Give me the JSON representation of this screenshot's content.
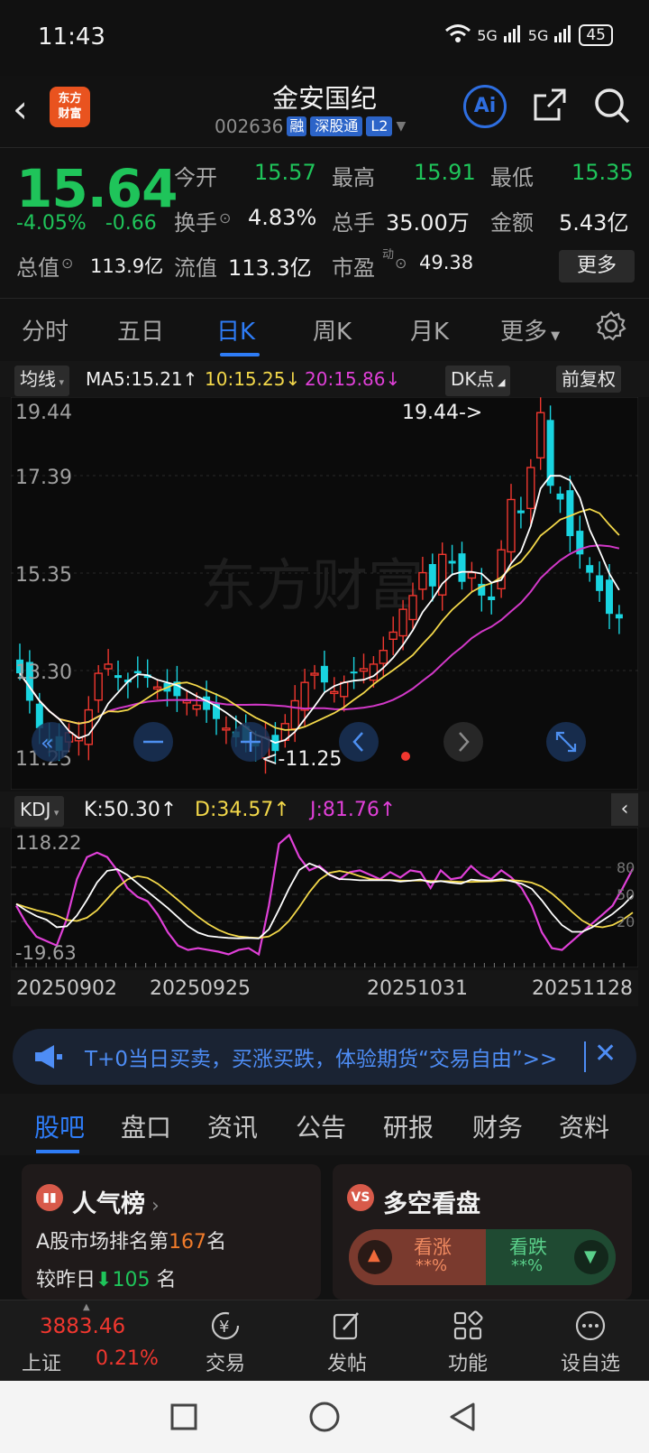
{
  "status_bar": {
    "time": "11:43",
    "signal1": "5G",
    "signal2": "5G",
    "battery": "45"
  },
  "header": {
    "logo_line1": "东方",
    "logo_line2": "财富",
    "stock_name": "金安国纪",
    "code": "002636",
    "tag_margin": "融",
    "tag_connect": "深股通",
    "tag_level": "L2",
    "ai_label": "Ai"
  },
  "quote": {
    "price": "15.64",
    "change_pct": "-4.05%",
    "change_amt": "-0.66",
    "open_label": "今开",
    "open": "15.57",
    "high_label": "最高",
    "high": "15.91",
    "low_label": "最低",
    "low": "15.35",
    "turnover_label": "换手",
    "turnover": "4.83%",
    "volume_label": "总手",
    "volume": "35.00万",
    "amount_label": "金额",
    "amount": "5.43亿",
    "mktcap_label": "总值",
    "mktcap": "113.9亿",
    "float_label": "流值",
    "float": "113.3亿",
    "pe_label": "市盈",
    "pe_sup": "动",
    "pe": "49.38",
    "more_label": "更多"
  },
  "period_tabs": [
    "分时",
    "五日",
    "日K",
    "周K",
    "月K",
    "更多"
  ],
  "active_period": "日K",
  "ma_legend": {
    "chip": "均线",
    "ma5": "MA5:15.21↑",
    "ma10": "10:15.25↓",
    "ma20": "20:15.86↓",
    "dk": "DK点",
    "adjust": "前复权"
  },
  "kline": {
    "price_labels": [
      "19.44",
      "17.39",
      "15.35",
      "13.30",
      "11.25"
    ],
    "max_marker": "19.44->",
    "min_marker": "<-11.25",
    "watermark": "东方财富"
  },
  "kdj_legend": {
    "chip": "KDJ",
    "k": "K:50.30↑",
    "d": "D:34.57↑",
    "j": "J:81.76↑"
  },
  "kdj_scale": {
    "top": "118.22",
    "bottom": "-19.63",
    "r80": "80",
    "r50": "50",
    "r20": "20"
  },
  "dates": [
    "20250902",
    "20250925",
    "20251031",
    "20251128"
  ],
  "banner": {
    "text": "T+0当日买卖，买涨买跌，体验期货“交易自由”>>"
  },
  "info_tabs": [
    "股吧",
    "盘口",
    "资讯",
    "公告",
    "研报",
    "财务",
    "资料"
  ],
  "active_info_tab": "股吧",
  "card_popularity": {
    "title": "人气榜",
    "rank_prefix": "A股市场排名第",
    "rank": "167",
    "rank_suffix": "名",
    "compare_prefix": "较昨日",
    "compare_value": "105",
    "compare_suffix": "名"
  },
  "card_duokong": {
    "title": "多空看盘",
    "icon": "VS",
    "up_label": "看涨",
    "up_value": "**%",
    "down_label": "看跌",
    "down_value": "**%"
  },
  "bottom_nav": {
    "index_value": "3883.46",
    "index_name": "上证",
    "index_pct": "0.21%",
    "items": [
      "交易",
      "发帖",
      "功能",
      "设自选"
    ]
  }
}
